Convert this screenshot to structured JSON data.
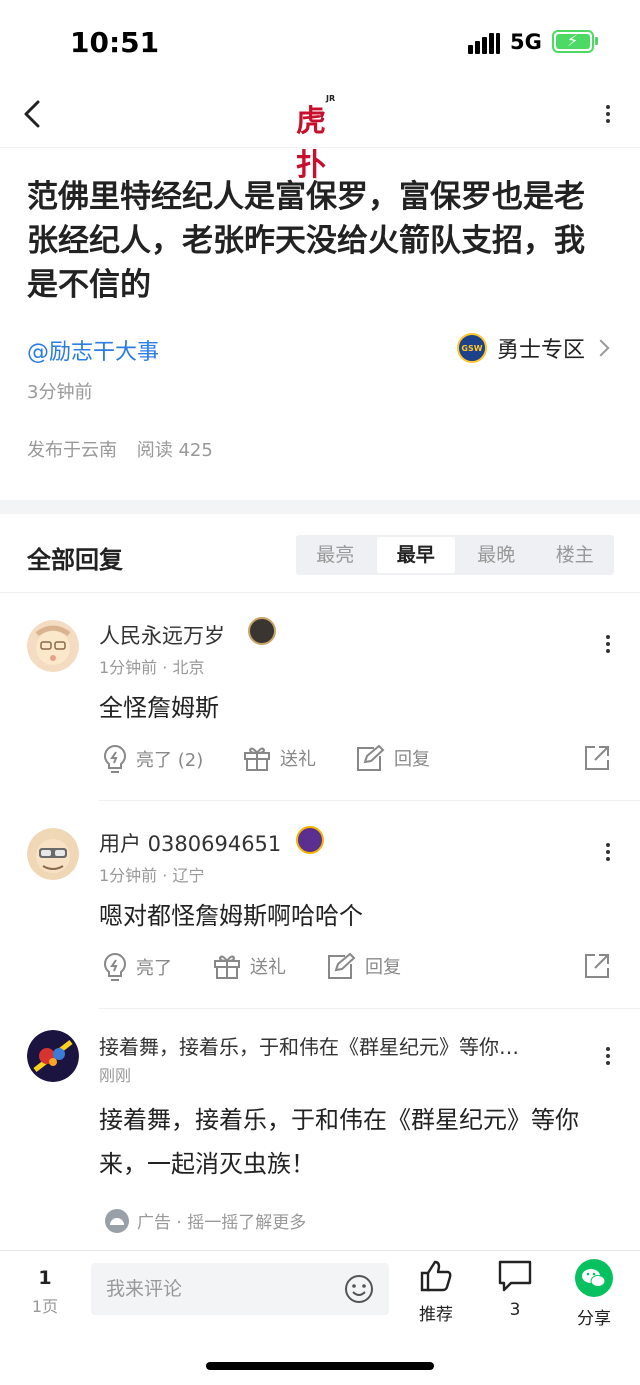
{
  "status_bar": {
    "time": "10:51",
    "network": "5G"
  },
  "nav": {
    "logo_text": "虎扑",
    "logo_sup": "JR"
  },
  "post": {
    "title": "范佛里特经纪人是富保罗，富保罗也是老张经纪人，老张昨天没给火箭队支招，我是不信的",
    "author": "@励志干大事",
    "zone_badge": "GSW",
    "zone_label": "勇士专区",
    "time": "3分钟前",
    "location": "发布于云南",
    "read_count": "阅读 425"
  },
  "replies": {
    "title": "全部回复",
    "sort_tabs": [
      "最亮",
      "最早",
      "最晚",
      "楼主"
    ],
    "active_tab": "最早",
    "comments": [
      {
        "name": "人民永远万岁",
        "meta": "1分钟前 · 北京",
        "text": "全怪詹姆斯",
        "like_label": "亮了 (2)",
        "gift_label": "送礼",
        "reply_label": "回复"
      },
      {
        "name": "用户 0380694651",
        "meta": "1分钟前 · 辽宁",
        "text": "嗯对都怪詹姆斯啊哈哈个",
        "like_label": "亮了",
        "gift_label": "送礼",
        "reply_label": "回复"
      }
    ],
    "ad": {
      "name": "接着舞，接着乐，于和伟在《群星纪元》等你…",
      "meta": "刚刚",
      "text": "接着舞，接着乐，于和伟在《群星纪元》等你来，一起消灭虫族！",
      "footer": "广告 · 摇一摇了解更多"
    }
  },
  "bottom_bar": {
    "page_number": "1",
    "page_label": "1页",
    "input_placeholder": "我来评论",
    "recommend_label": "推荐",
    "comment_count": "3",
    "share_label": "分享"
  },
  "colors": {
    "accent": "#2b7de3",
    "brand": "#c8102e",
    "share_green": "#07c160"
  }
}
